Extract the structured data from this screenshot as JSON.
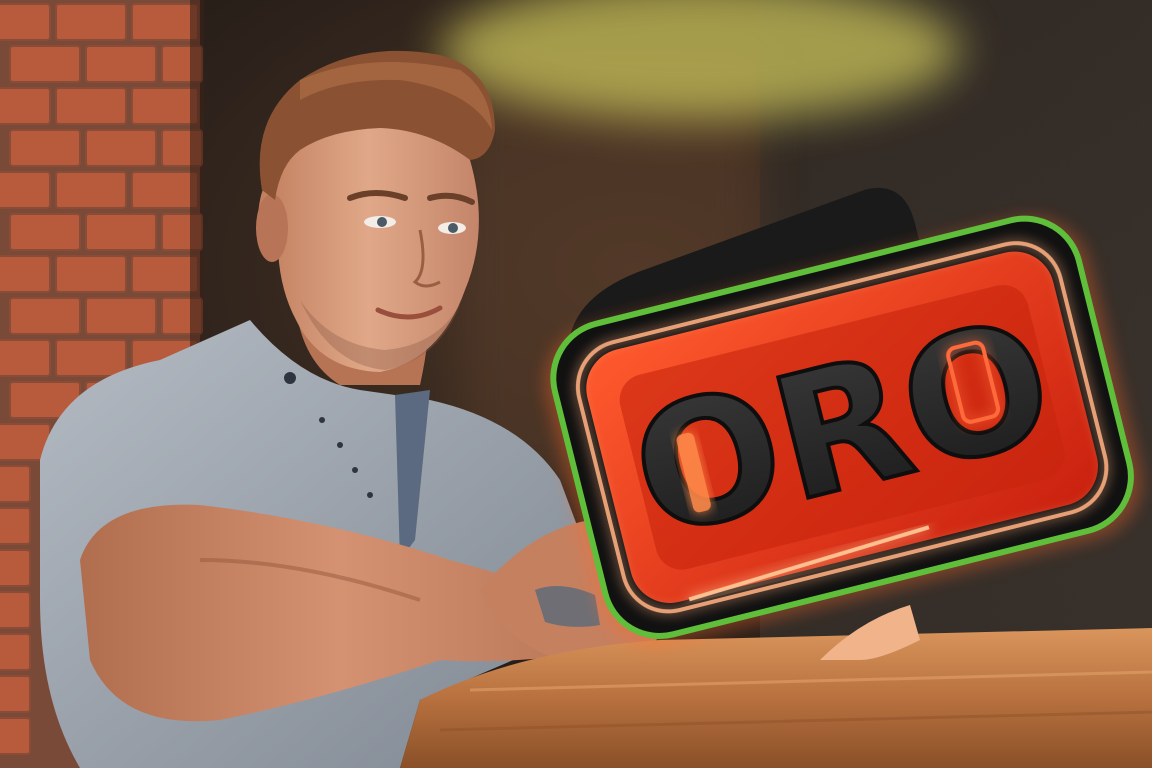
{
  "scene": {
    "description_tags": [
      "brick-wall",
      "man",
      "wooden-counter",
      "neon-sign"
    ],
    "colors": {
      "background_dark": "#1e1814",
      "background_warm": "#3a2a20",
      "brick": "#b85a3c",
      "brick_mortar": "#7a4a38",
      "shirt": "#9aa2ac",
      "skin": "#c98565",
      "hair": "#8a5232",
      "wood": "#c8834e",
      "sign_outer": "#141414",
      "sign_red": "#e8361c",
      "sign_glow": "#ff7a3a",
      "sign_green": "#5fbf3a",
      "blur_yellow": "#c9c25a"
    }
  },
  "sign": {
    "text": "ORO"
  }
}
